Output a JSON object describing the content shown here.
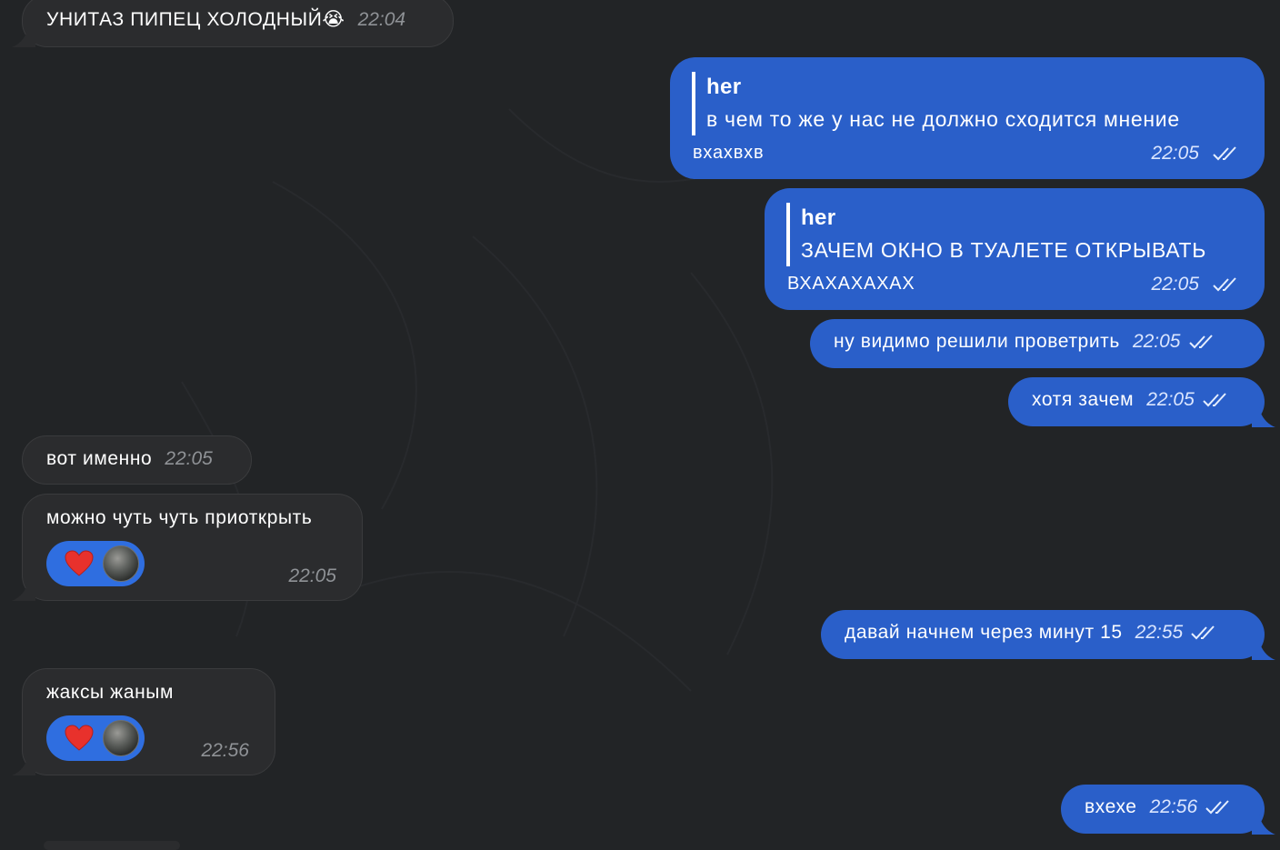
{
  "chat": {
    "messages": [
      {
        "id": "m1",
        "side": "in",
        "text": "УНИТАЗ ПИПЕЦ ХОЛОДНЫЙ😭",
        "time": "22:04"
      },
      {
        "id": "m2",
        "side": "out",
        "reply_to": "her",
        "quote": "в чем то же у нас не должно сходится мнение",
        "text": "вхахвхв",
        "time": "22:05",
        "status": "read"
      },
      {
        "id": "m3",
        "side": "out",
        "reply_to": "her",
        "quote": "ЗАЧЕМ ОКНО В ТУАЛЕТЕ ОТКРЫВАТЬ",
        "text": "ВХАХАХАХАХ",
        "time": "22:05",
        "status": "read"
      },
      {
        "id": "m4",
        "side": "out",
        "text": "ну видимо решили проветрить",
        "time": "22:05",
        "status": "read"
      },
      {
        "id": "m5",
        "side": "out",
        "text": "хотя зачем",
        "time": "22:05",
        "status": "read"
      },
      {
        "id": "m6",
        "side": "in",
        "text": "вот именно",
        "time": "22:05"
      },
      {
        "id": "m7",
        "side": "in",
        "text": "можно чуть чуть приоткрыть",
        "time": "22:05",
        "reaction": "heart-icon"
      },
      {
        "id": "m8",
        "side": "out",
        "text": "давай начнем через минут 15",
        "time": "22:55",
        "status": "read"
      },
      {
        "id": "m9",
        "side": "in",
        "text": "жаксы жаным",
        "time": "22:56",
        "reaction": "heart-icon"
      },
      {
        "id": "m10",
        "side": "out",
        "text": "вхехе",
        "time": "22:56",
        "status": "read"
      }
    ]
  },
  "colors": {
    "background": "#222426",
    "incoming_bubble": "#2b2c2e",
    "outgoing_bubble": "#2a5fc9",
    "reaction_pill": "#2f6ee0",
    "heart": "#e8312c"
  }
}
